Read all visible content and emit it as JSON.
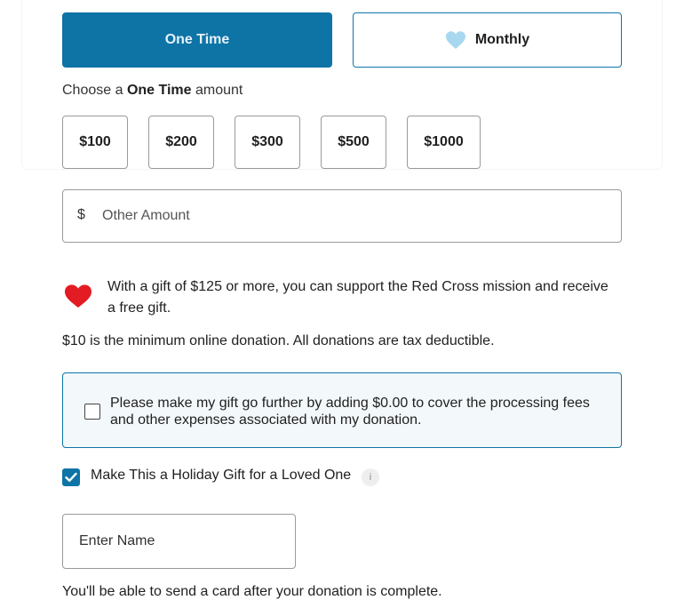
{
  "frequency": {
    "one_time_label": "One Time",
    "monthly_label": "Monthly",
    "selected": "One Time"
  },
  "choose": {
    "prefix": "Choose a ",
    "selected_frequency": "One Time",
    "suffix": " amount"
  },
  "amounts": [
    {
      "label": "$100"
    },
    {
      "label": "$200"
    },
    {
      "label": "$300"
    },
    {
      "label": "$500"
    },
    {
      "label": "$1000"
    }
  ],
  "other_amount": {
    "currency_symbol": "$",
    "placeholder": "Other Amount",
    "value": ""
  },
  "gift_message": "With a gift of $125 or more, you can support the Red Cross mission and receive a free gift.",
  "minimum_message": "$10 is the minimum online donation. All donations are tax deductible.",
  "processing_fees": {
    "label": "Please make my gift go further by adding $0.00 to cover the processing fees and other expenses associated with my donation.",
    "checked": false
  },
  "holiday_gift": {
    "label": "Make This a Holiday Gift for a Loved One",
    "checked": true,
    "info_glyph": "i"
  },
  "name_field": {
    "placeholder": "Enter Name",
    "value": ""
  },
  "card_note": "You'll be able to send a card after your donation is complete.",
  "colors": {
    "accent": "#0e74a6",
    "heart_red": "#e31b23",
    "monthly_heart": "#a8d8f0"
  },
  "icons": {
    "monthly": "heart-icon",
    "gift": "heart-icon",
    "info": "info-icon",
    "check": "checkmark-icon"
  }
}
